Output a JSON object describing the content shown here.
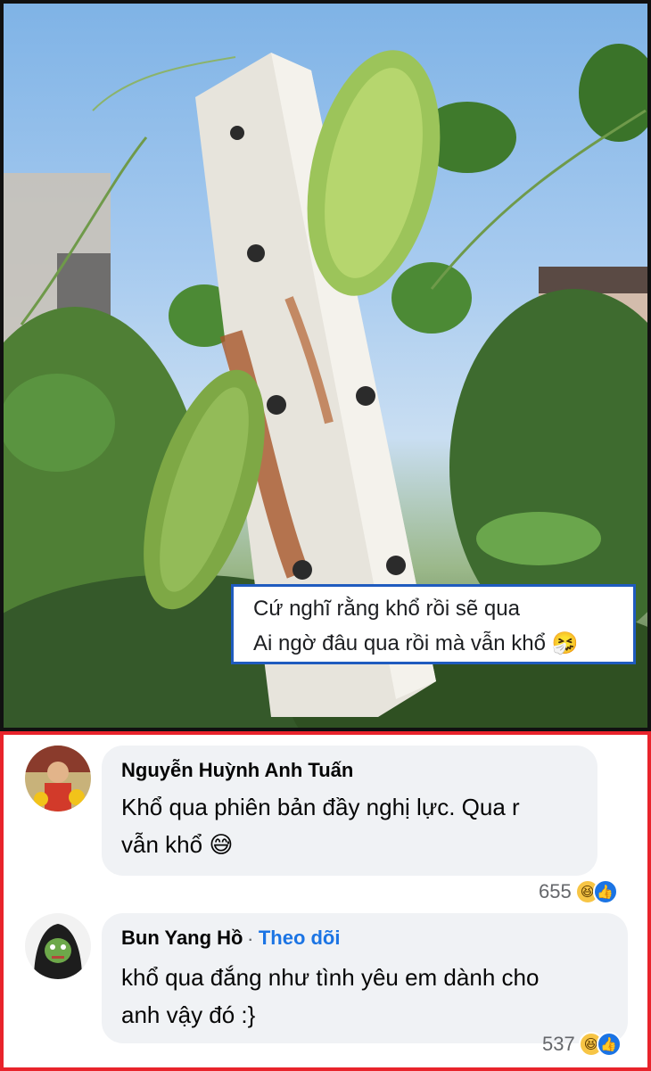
{
  "photo": {
    "caption_lines": [
      "Cứ nghĩ rằng khổ rồi sẽ qua",
      "Ai ngờ đâu qua rồi mà vẫn khổ"
    ],
    "caption_emoji": "🤧",
    "caption_border_color": "#1f5bbf"
  },
  "comments": [
    {
      "author": "Nguyễn Huỳnh Anh Tuấn",
      "text_line1": "Khổ qua phiên bản đầy nghị lực. Qua r",
      "text_line2": "vẫn khổ",
      "emoji": "😅",
      "reaction_count": "655",
      "reaction_icons": [
        "haha-icon",
        "like-icon"
      ]
    },
    {
      "author": "Bun Yang Hồ",
      "separator": "·",
      "follow_label": "Theo dõi",
      "text_line1": "khổ qua đắng như tình yêu em dành cho",
      "text_line2": "anh vậy đó :}",
      "reaction_count": "537",
      "reaction_icons": [
        "haha-icon",
        "like-icon"
      ]
    }
  ],
  "colors": {
    "highlight_border": "#e8232b",
    "follow_link": "#1b74e4",
    "bubble_bg": "#f0f2f5"
  }
}
